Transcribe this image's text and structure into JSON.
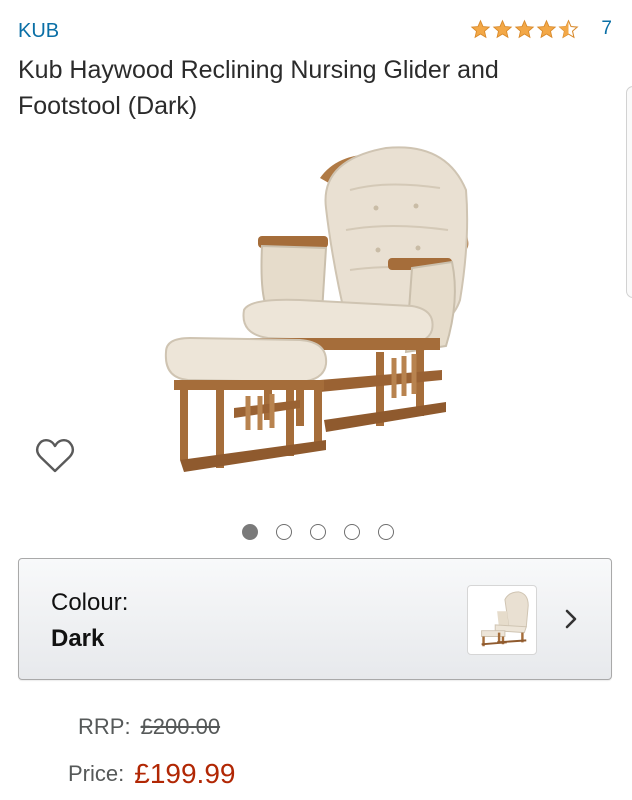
{
  "product": {
    "brand": "KUB",
    "rating_count": "7",
    "rating_value": 4.5,
    "title": "Kub Haywood Reclining Nursing Glider and Footstool (Dark)"
  },
  "gallery": {
    "image_count": 5,
    "active_index": 0
  },
  "variation": {
    "label": "Colour:",
    "value": "Dark"
  },
  "pricing": {
    "rrp_label": "RRP:",
    "rrp_value": "£200.00",
    "price_label": "Price:",
    "price_value": "£199.99"
  },
  "colors": {
    "link_blue": "#0a6fa6",
    "star_orange": "#f3a847",
    "price_red": "#b12704"
  },
  "icons": {
    "wishlist": "heart-outline-icon",
    "chevron": "chevron-right-icon"
  }
}
